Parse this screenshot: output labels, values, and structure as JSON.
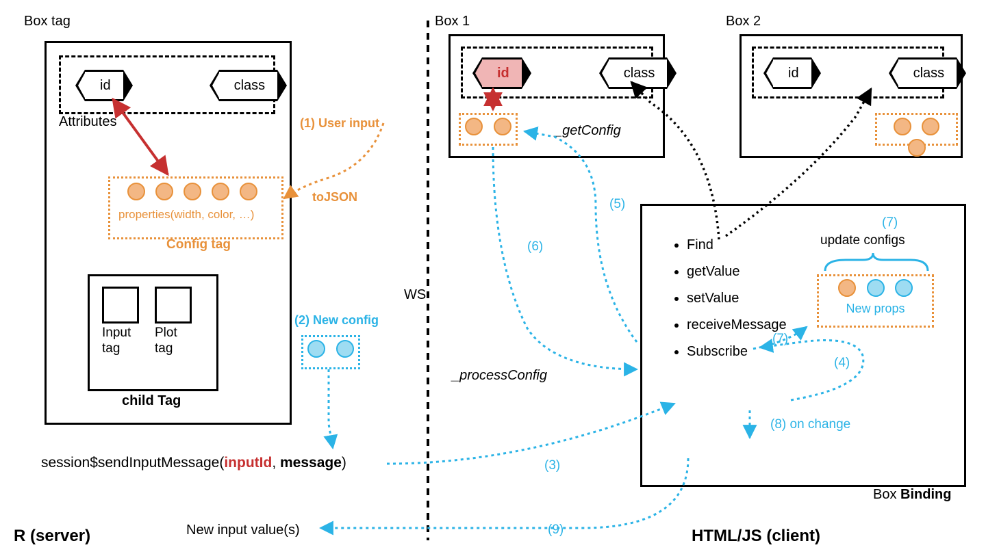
{
  "left": {
    "title": "Box tag",
    "attributesLabel": "Attributes",
    "idTag": "id",
    "classTag": "class",
    "propertiesLabel": "properties(width, color, …)",
    "configTagLabel": "Config tag",
    "child": {
      "heading": "child Tag",
      "inputTag": "Input tag",
      "plotTag": "Plot tag"
    },
    "userInputStep": "(1) User input",
    "toJSON": "toJSON",
    "newConfigStep": "(2) New config",
    "sendMessage": {
      "prefix": "session$sendInputMessage(",
      "arg1": "inputId",
      "comma": ", ",
      "arg2": "message",
      "suffix": ")"
    },
    "newInputValues": "New input value(s)",
    "sideLabel": "R (server)"
  },
  "mid": {
    "ws": "WS",
    "box1Label": "Box 1",
    "box2Label": "Box 2",
    "idTag": "id",
    "classTag": "class",
    "getConfig": "_getConfig",
    "processConfig": "_processConfig"
  },
  "right": {
    "binding": {
      "find": "Find",
      "getValue": "getValue",
      "setValue": "setValue",
      "receiveMessage": "receiveMessage",
      "subscribe": "Subscribe"
    },
    "updateConfigs": "update configs",
    "newProps": "New props",
    "boxBinding": "Box Binding",
    "steps": {
      "s3": "(3)",
      "s4": "(4)",
      "s5": "(5)",
      "s6": "(6)",
      "s7a": "(7)",
      "s7b": "(7)",
      "s8": "(8) on change",
      "s9": "(9)"
    },
    "sideLabel": "HTML/JS (client)"
  }
}
